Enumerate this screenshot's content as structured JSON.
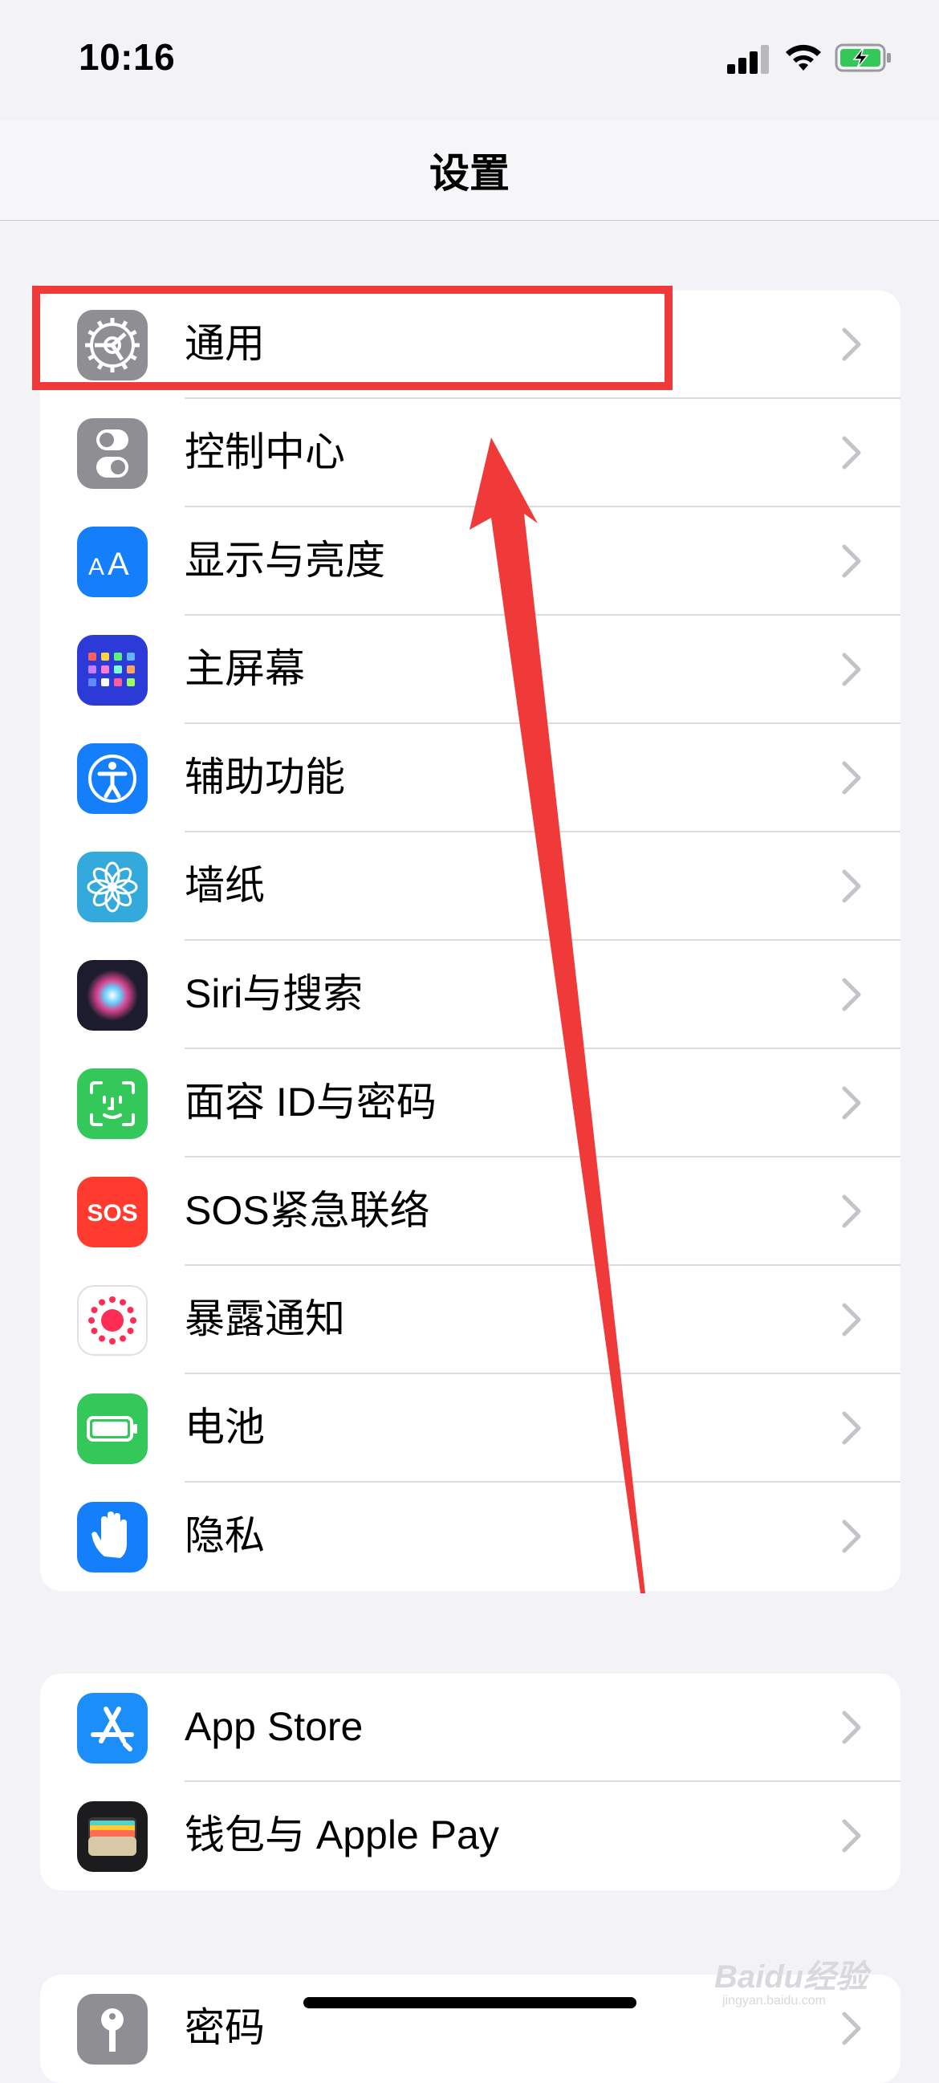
{
  "status": {
    "time": "10:16"
  },
  "nav": {
    "title": "设置"
  },
  "group1": [
    {
      "label": "通用",
      "icon": "gear-icon",
      "color": "#8e8e93"
    },
    {
      "label": "控制中心",
      "icon": "switches-icon",
      "color": "#8e8e93"
    },
    {
      "label": "显示与亮度",
      "icon": "text-size-icon",
      "color": "#147efb"
    },
    {
      "label": "主屏幕",
      "icon": "home-grid-icon",
      "color": "#2c3ad8"
    },
    {
      "label": "辅助功能",
      "icon": "accessibility-icon",
      "color": "#147efb"
    },
    {
      "label": "墙纸",
      "icon": "flower-icon",
      "color": "#34aadc"
    },
    {
      "label": "Siri与搜索",
      "icon": "siri-icon",
      "color": "#1c1c2e"
    },
    {
      "label": "面容 ID与密码",
      "icon": "face-id-icon",
      "color": "#34c759"
    },
    {
      "label": "SOS紧急联络",
      "icon": "sos-icon",
      "color": "#ff3b30",
      "text": "SOS"
    },
    {
      "label": "暴露通知",
      "icon": "exposure-icon",
      "color": "#ffffff"
    },
    {
      "label": "电池",
      "icon": "battery-icon",
      "color": "#34c759"
    },
    {
      "label": "隐私",
      "icon": "hand-icon",
      "color": "#147efb"
    }
  ],
  "group2": [
    {
      "label": "App Store",
      "icon": "app-store-icon",
      "color": "#1c8ef9"
    },
    {
      "label": "钱包与 Apple Pay",
      "icon": "wallet-icon",
      "color": "#1c1c1e"
    }
  ],
  "group3": [
    {
      "label": "密码",
      "icon": "key-icon",
      "color": "#8e8e93"
    }
  ],
  "watermark": {
    "text": "Baidu经验",
    "sub": "jingyan.baidu.com"
  },
  "annotation_color": "#f03a3a"
}
